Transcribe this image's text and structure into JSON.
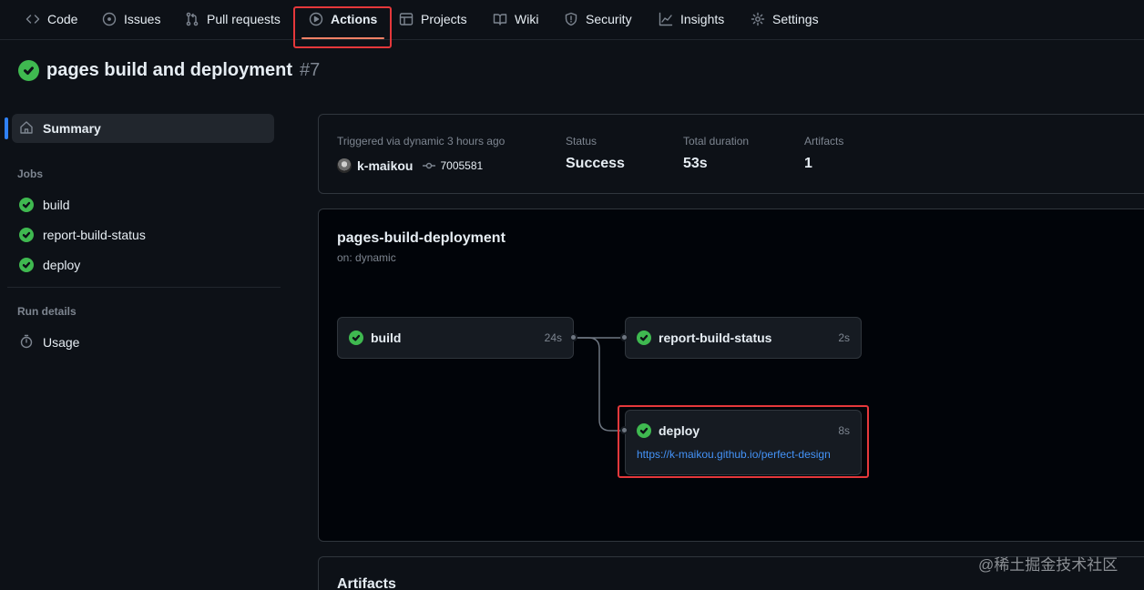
{
  "nav": {
    "tabs": [
      {
        "label": "Code",
        "icon": "code-icon"
      },
      {
        "label": "Issues",
        "icon": "issue-icon"
      },
      {
        "label": "Pull requests",
        "icon": "pull-request-icon"
      },
      {
        "label": "Actions",
        "icon": "play-icon",
        "active": true
      },
      {
        "label": "Projects",
        "icon": "table-icon"
      },
      {
        "label": "Wiki",
        "icon": "book-icon"
      },
      {
        "label": "Security",
        "icon": "shield-icon"
      },
      {
        "label": "Insights",
        "icon": "graph-icon"
      },
      {
        "label": "Settings",
        "icon": "gear-icon"
      }
    ]
  },
  "run": {
    "title": "pages build and deployment",
    "number": "#7",
    "status_color": "#3fb950"
  },
  "sidebar": {
    "summary_label": "Summary",
    "jobs_heading": "Jobs",
    "jobs": [
      {
        "label": "build"
      },
      {
        "label": "report-build-status"
      },
      {
        "label": "deploy"
      }
    ],
    "run_details_heading": "Run details",
    "usage_label": "Usage"
  },
  "summary": {
    "trigger_label": "Triggered via dynamic 3 hours ago",
    "actor": "k-maikou",
    "commit": "7005581",
    "status_label": "Status",
    "status_value": "Success",
    "duration_label": "Total duration",
    "duration_value": "53s",
    "artifacts_label": "Artifacts",
    "artifacts_value": "1"
  },
  "workflow": {
    "name": "pages-build-deployment",
    "trigger": "on: dynamic",
    "jobs": {
      "build": {
        "name": "build",
        "duration": "24s"
      },
      "report": {
        "name": "report-build-status",
        "duration": "2s"
      },
      "deploy": {
        "name": "deploy",
        "duration": "8s",
        "url": "https://k-maikou.github.io/perfect-design"
      }
    }
  },
  "artifacts": {
    "heading": "Artifacts"
  },
  "watermark": "@稀土掘金技术社区",
  "colors": {
    "accent_link": "#4493f8",
    "success": "#3fb950",
    "highlight_box": "#e5383b",
    "active_tab_underline": "#f78166"
  }
}
